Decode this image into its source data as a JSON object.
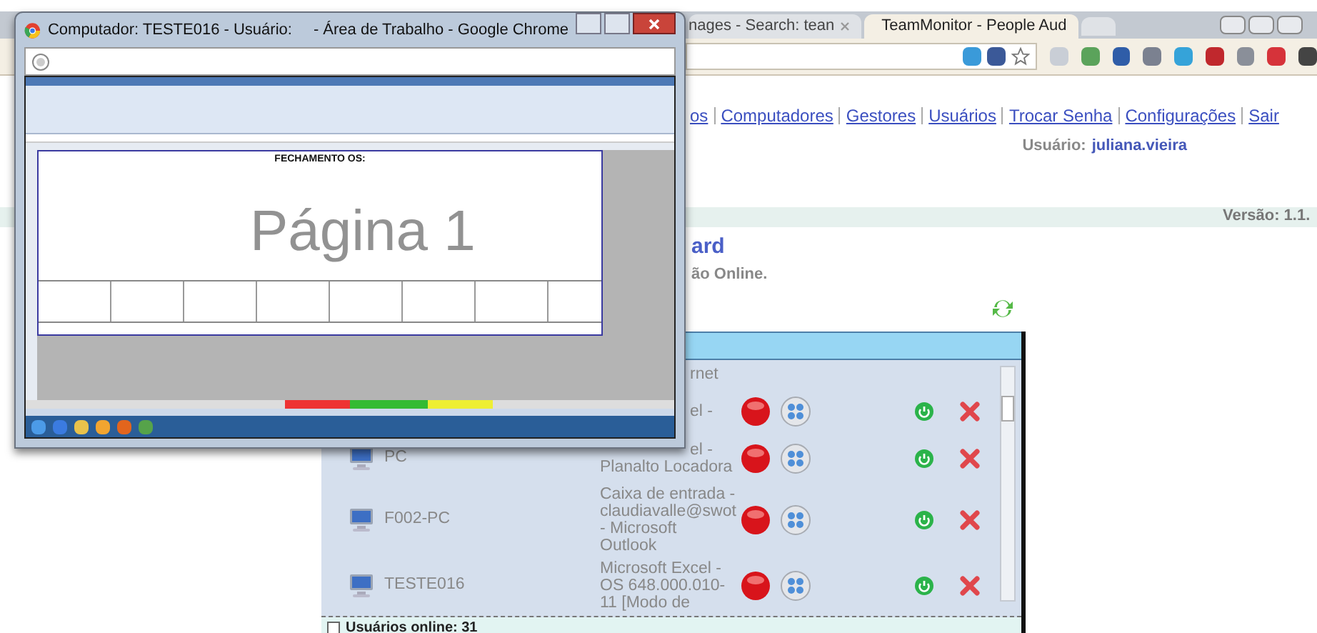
{
  "remote_window": {
    "title_left": "Computador: TESTE016 - Usuário:",
    "title_right": "- Área de Trabalho - Google Chrome",
    "sheet_title": "FECHAMENTO OS:",
    "page_label": "Página 1"
  },
  "browser": {
    "tabs": [
      {
        "label": "nages - Search: tean",
        "selected": false
      },
      {
        "label": "TeamMonitor - People Aud",
        "selected": true
      }
    ]
  },
  "nav": [
    "os",
    "Computadores",
    "Gestores",
    "Usuários",
    "Trocar Senha",
    "Configurações",
    "Sair"
  ],
  "user": {
    "label": "Usuário:",
    "name": "juliana.vieira"
  },
  "version": "Versão: 1.1.",
  "heading": "ard",
  "subtitle": "ão Online.",
  "computers": {
    "rows": [
      {
        "partial": true,
        "window_lines": [
          {
            "text": "rnet",
            "cut": true
          }
        ]
      },
      {
        "partial": false,
        "window_lines": [
          {
            "text": "el -",
            "cut": true
          }
        ]
      },
      {
        "partial": false,
        "computer": "PC",
        "window_lines": [
          {
            "text": "el -",
            "cut": true
          },
          {
            "text": "Planalto Locadora",
            "cut": false
          }
        ]
      },
      {
        "partial": false,
        "computer": "F002-PC",
        "window_lines": [
          {
            "text": "Caixa de entrada -",
            "cut": false
          },
          {
            "text": "claudiavalle@swot",
            "cut": false
          },
          {
            "text": "- Microsoft",
            "cut": false
          },
          {
            "text": "Outlook",
            "cut": false
          }
        ]
      },
      {
        "partial": false,
        "computer": "TESTE016",
        "window_lines": [
          {
            "text": "Microsoft Excel -",
            "cut": false
          },
          {
            "text": "OS 648.000.010-",
            "cut": false
          },
          {
            "text": "11 [Modo de",
            "cut": false
          }
        ]
      }
    ],
    "footer": "Usuários online: 31"
  }
}
